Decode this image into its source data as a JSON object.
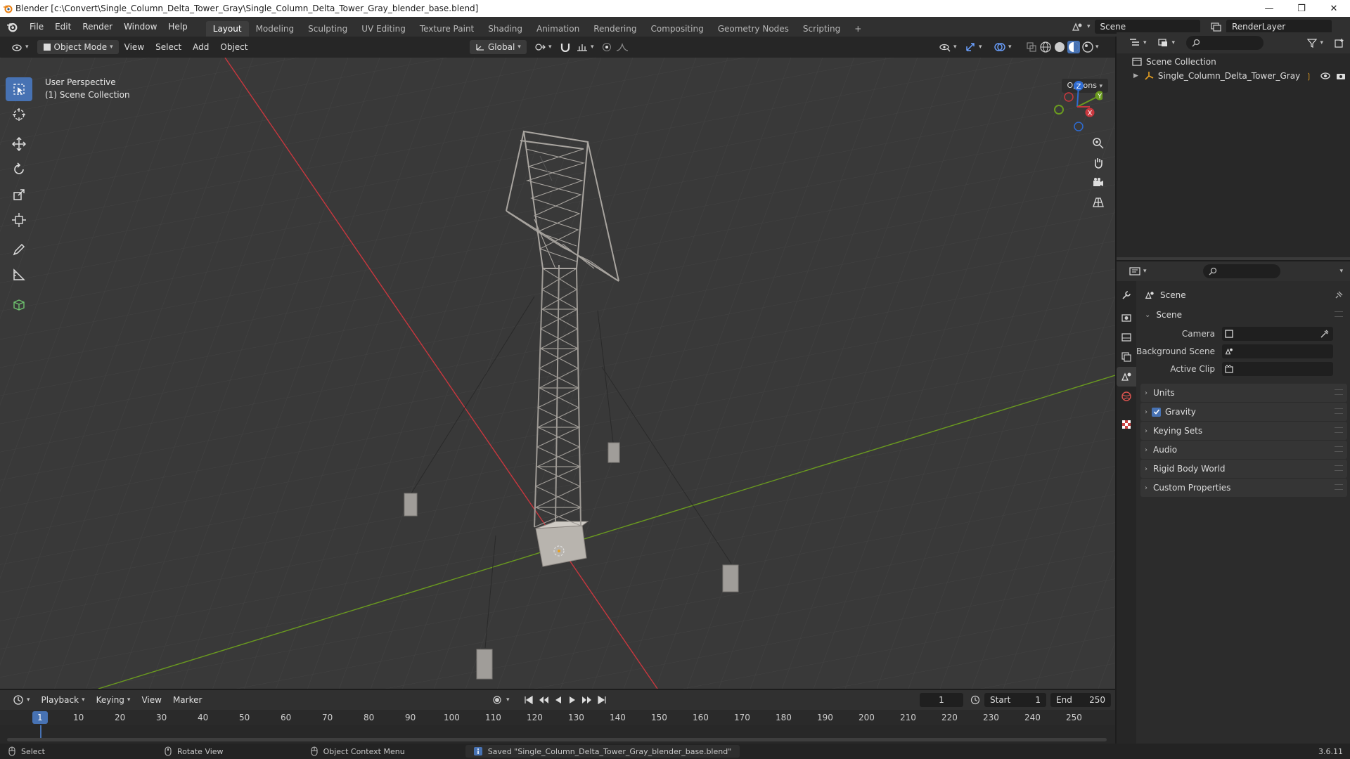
{
  "window": {
    "title": "Blender [c:\\Convert\\Single_Column_Delta_Tower_Gray\\Single_Column_Delta_Tower_Gray_blender_base.blend]"
  },
  "menu": [
    "File",
    "Edit",
    "Render",
    "Window",
    "Help"
  ],
  "workspaces": {
    "tabs": [
      "Layout",
      "Modeling",
      "Sculpting",
      "UV Editing",
      "Texture Paint",
      "Shading",
      "Animation",
      "Rendering",
      "Compositing",
      "Geometry Nodes",
      "Scripting"
    ],
    "active": "Layout",
    "add": "+"
  },
  "scene_selector": {
    "value": "Scene"
  },
  "view_layer": {
    "value": "RenderLayer"
  },
  "viewport_header": {
    "mode": "Object Mode",
    "menus": [
      "View",
      "Select",
      "Add",
      "Object"
    ],
    "transform_orientation": "Global",
    "options": "Options"
  },
  "viewport": {
    "perspective": "User Perspective",
    "collection": "(1) Scene Collection",
    "gizmo": {
      "x": "X",
      "y": "Y",
      "z": "Z"
    }
  },
  "outliner": {
    "root": "Scene Collection",
    "items": [
      {
        "label": "Single_Column_Delta_Tower_Gray"
      }
    ]
  },
  "properties": {
    "context": "Scene",
    "scene_panel": {
      "title": "Scene",
      "fields": [
        {
          "label": "Camera",
          "value": ""
        },
        {
          "label": "Background Scene",
          "value": ""
        },
        {
          "label": "Active Clip",
          "value": ""
        }
      ]
    },
    "subpanels": [
      {
        "label": "Units",
        "checkbox": false
      },
      {
        "label": "Gravity",
        "checkbox": true
      },
      {
        "label": "Keying Sets",
        "checkbox": false
      },
      {
        "label": "Audio",
        "checkbox": false
      },
      {
        "label": "Rigid Body World",
        "checkbox": false
      },
      {
        "label": "Custom Properties",
        "checkbox": false
      }
    ]
  },
  "timeline": {
    "menus": [
      "Playback",
      "Keying",
      "View",
      "Marker"
    ],
    "current_frame": "1",
    "start_label": "Start",
    "start": "1",
    "end_label": "End",
    "end": "250",
    "ruler": [
      "1",
      "10",
      "20",
      "30",
      "40",
      "50",
      "60",
      "70",
      "80",
      "90",
      "100",
      "110",
      "120",
      "130",
      "140",
      "150",
      "160",
      "170",
      "180",
      "190",
      "200",
      "210",
      "220",
      "230",
      "240",
      "250"
    ]
  },
  "statusbar": {
    "select": "Select",
    "rotate": "Rotate View",
    "context_menu": "Object Context Menu",
    "message": "Saved \"Single_Column_Delta_Tower_Gray_blender_base.blend\"",
    "version": "3.6.11"
  },
  "colors": {
    "accent": "#4772b3",
    "x_axis": "#c9373e",
    "y_axis": "#6a9a1f",
    "z_axis": "#2e6bd1"
  }
}
